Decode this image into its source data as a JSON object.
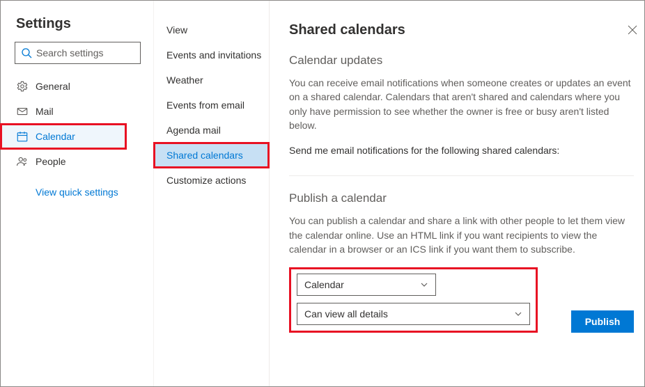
{
  "title": "Settings",
  "search": {
    "placeholder": "Search settings"
  },
  "sidebar": {
    "items": [
      {
        "label": "General"
      },
      {
        "label": "Mail"
      },
      {
        "label": "Calendar"
      },
      {
        "label": "People"
      }
    ],
    "quick_link": "View quick settings"
  },
  "sub": {
    "items": [
      {
        "label": "View"
      },
      {
        "label": "Events and invitations"
      },
      {
        "label": "Weather"
      },
      {
        "label": "Events from email"
      },
      {
        "label": "Agenda mail"
      },
      {
        "label": "Shared calendars"
      },
      {
        "label": "Customize actions"
      }
    ]
  },
  "panel": {
    "title": "Shared calendars",
    "updates": {
      "heading": "Calendar updates",
      "body": "You can receive email notifications when someone creates or updates an event on a shared calendar. Calendars that aren't shared and calendars where you only have permission to see whether the owner is free or busy aren't listed below.",
      "prompt": "Send me email notifications for the following shared calendars:"
    },
    "publish": {
      "heading": "Publish a calendar",
      "body": "You can publish a calendar and share a link with other people to let them view the calendar online. Use an HTML link if you want recipients to view the calendar in a browser or an ICS link if you want them to subscribe.",
      "calendar_select": "Calendar",
      "permission_select": "Can view all details",
      "button": "Publish"
    }
  }
}
